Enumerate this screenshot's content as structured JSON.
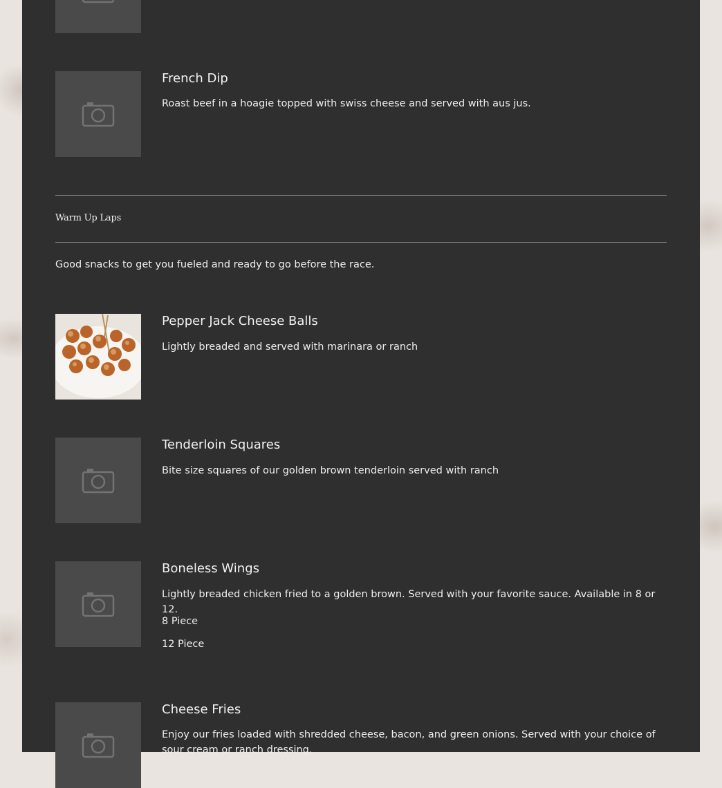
{
  "items_above": [
    {
      "title": "French Dip",
      "description": "Roast beef in a hoagie topped with swiss cheese and served with aus jus.",
      "image": "camera-placeholder-icon"
    }
  ],
  "section": {
    "title": "Warm Up Laps",
    "description": "Good snacks to get you fueled and ready to go before the race."
  },
  "items": [
    {
      "title": "Pepper Jack Cheese Balls",
      "description": "Lightly breaded and served with marinara or ranch",
      "image": "cheese-balls-photo"
    },
    {
      "title": "Tenderloin Squares",
      "description": "Bite size squares of our golden brown tenderloin served with ranch",
      "image": "camera-placeholder-icon"
    },
    {
      "title": "Boneless Wings",
      "description": "Lightly breaded chicken fried to a golden brown. Served with your favorite sauce. Available in 8 or 12.",
      "image": "camera-placeholder-icon",
      "options": [
        "8 Piece",
        "12 Piece"
      ]
    },
    {
      "title": "Cheese Fries",
      "description": "Enjoy our fries loaded with shredded cheese, bacon, and green onions. Served with your choice of sour cream or ranch dressing.",
      "image": "camera-placeholder-icon"
    }
  ],
  "colors": {
    "panel": "#2f2f2f",
    "placeholder": "#4a4a4a",
    "text": "#eeeeee"
  }
}
